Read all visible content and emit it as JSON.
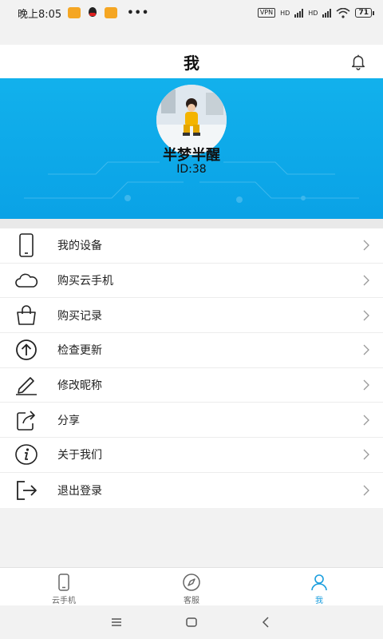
{
  "status_bar": {
    "time": "晚上8:05",
    "dots": "•••",
    "vpn": "VPN",
    "hd1": "HD",
    "hd2": "HD",
    "battery": "71"
  },
  "title_bar": {
    "title": "我"
  },
  "profile": {
    "nickname": "半梦半醒",
    "user_id": "ID:38"
  },
  "menu": {
    "items": [
      {
        "label": "我的设备",
        "icon": "phone-icon"
      },
      {
        "label": "购买云手机",
        "icon": "cloud-icon"
      },
      {
        "label": "购买记录",
        "icon": "shopping-bag-icon"
      },
      {
        "label": "检查更新",
        "icon": "arrow-up-circle-icon"
      },
      {
        "label": "修改昵称",
        "icon": "edit-icon"
      },
      {
        "label": "分享",
        "icon": "share-icon"
      },
      {
        "label": "关于我们",
        "icon": "info-icon"
      },
      {
        "label": "退出登录",
        "icon": "logout-icon"
      }
    ]
  },
  "bottom_nav": {
    "tabs": [
      {
        "label": "云手机",
        "icon": "phone-icon"
      },
      {
        "label": "客服",
        "icon": "compass-icon"
      },
      {
        "label": "我",
        "icon": "user-icon",
        "active": true
      }
    ]
  },
  "colors": {
    "accent": "#1a9ede",
    "header": "#0aa8e9"
  }
}
